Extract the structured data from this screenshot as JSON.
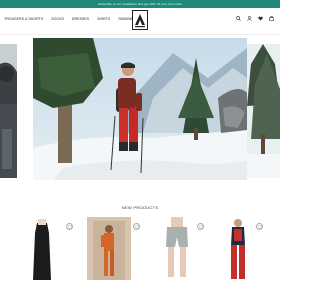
{
  "announcement": "Subscribe to our newsletter and get 10% off your first order",
  "nav": {
    "items": [
      "Trousers & Shorts",
      "Socks",
      "Dresses",
      "Shirts",
      "Swimwear"
    ]
  },
  "header_icons": [
    "search-icon",
    "user-icon",
    "heart-icon",
    "bag-icon"
  ],
  "hero": {
    "image": "skier-in-snowy-forest"
  },
  "new_products": {
    "title": "NEW PRODUCTS",
    "items": [
      {
        "image": "black-tank-dress"
      },
      {
        "image": "woman-in-orange-outfit"
      },
      {
        "image": "grey-shorts"
      },
      {
        "image": "red-swimsuit-and-trousers"
      }
    ]
  },
  "colors": {
    "accent": "#1f8a7a",
    "text": "#2a2a2a"
  }
}
